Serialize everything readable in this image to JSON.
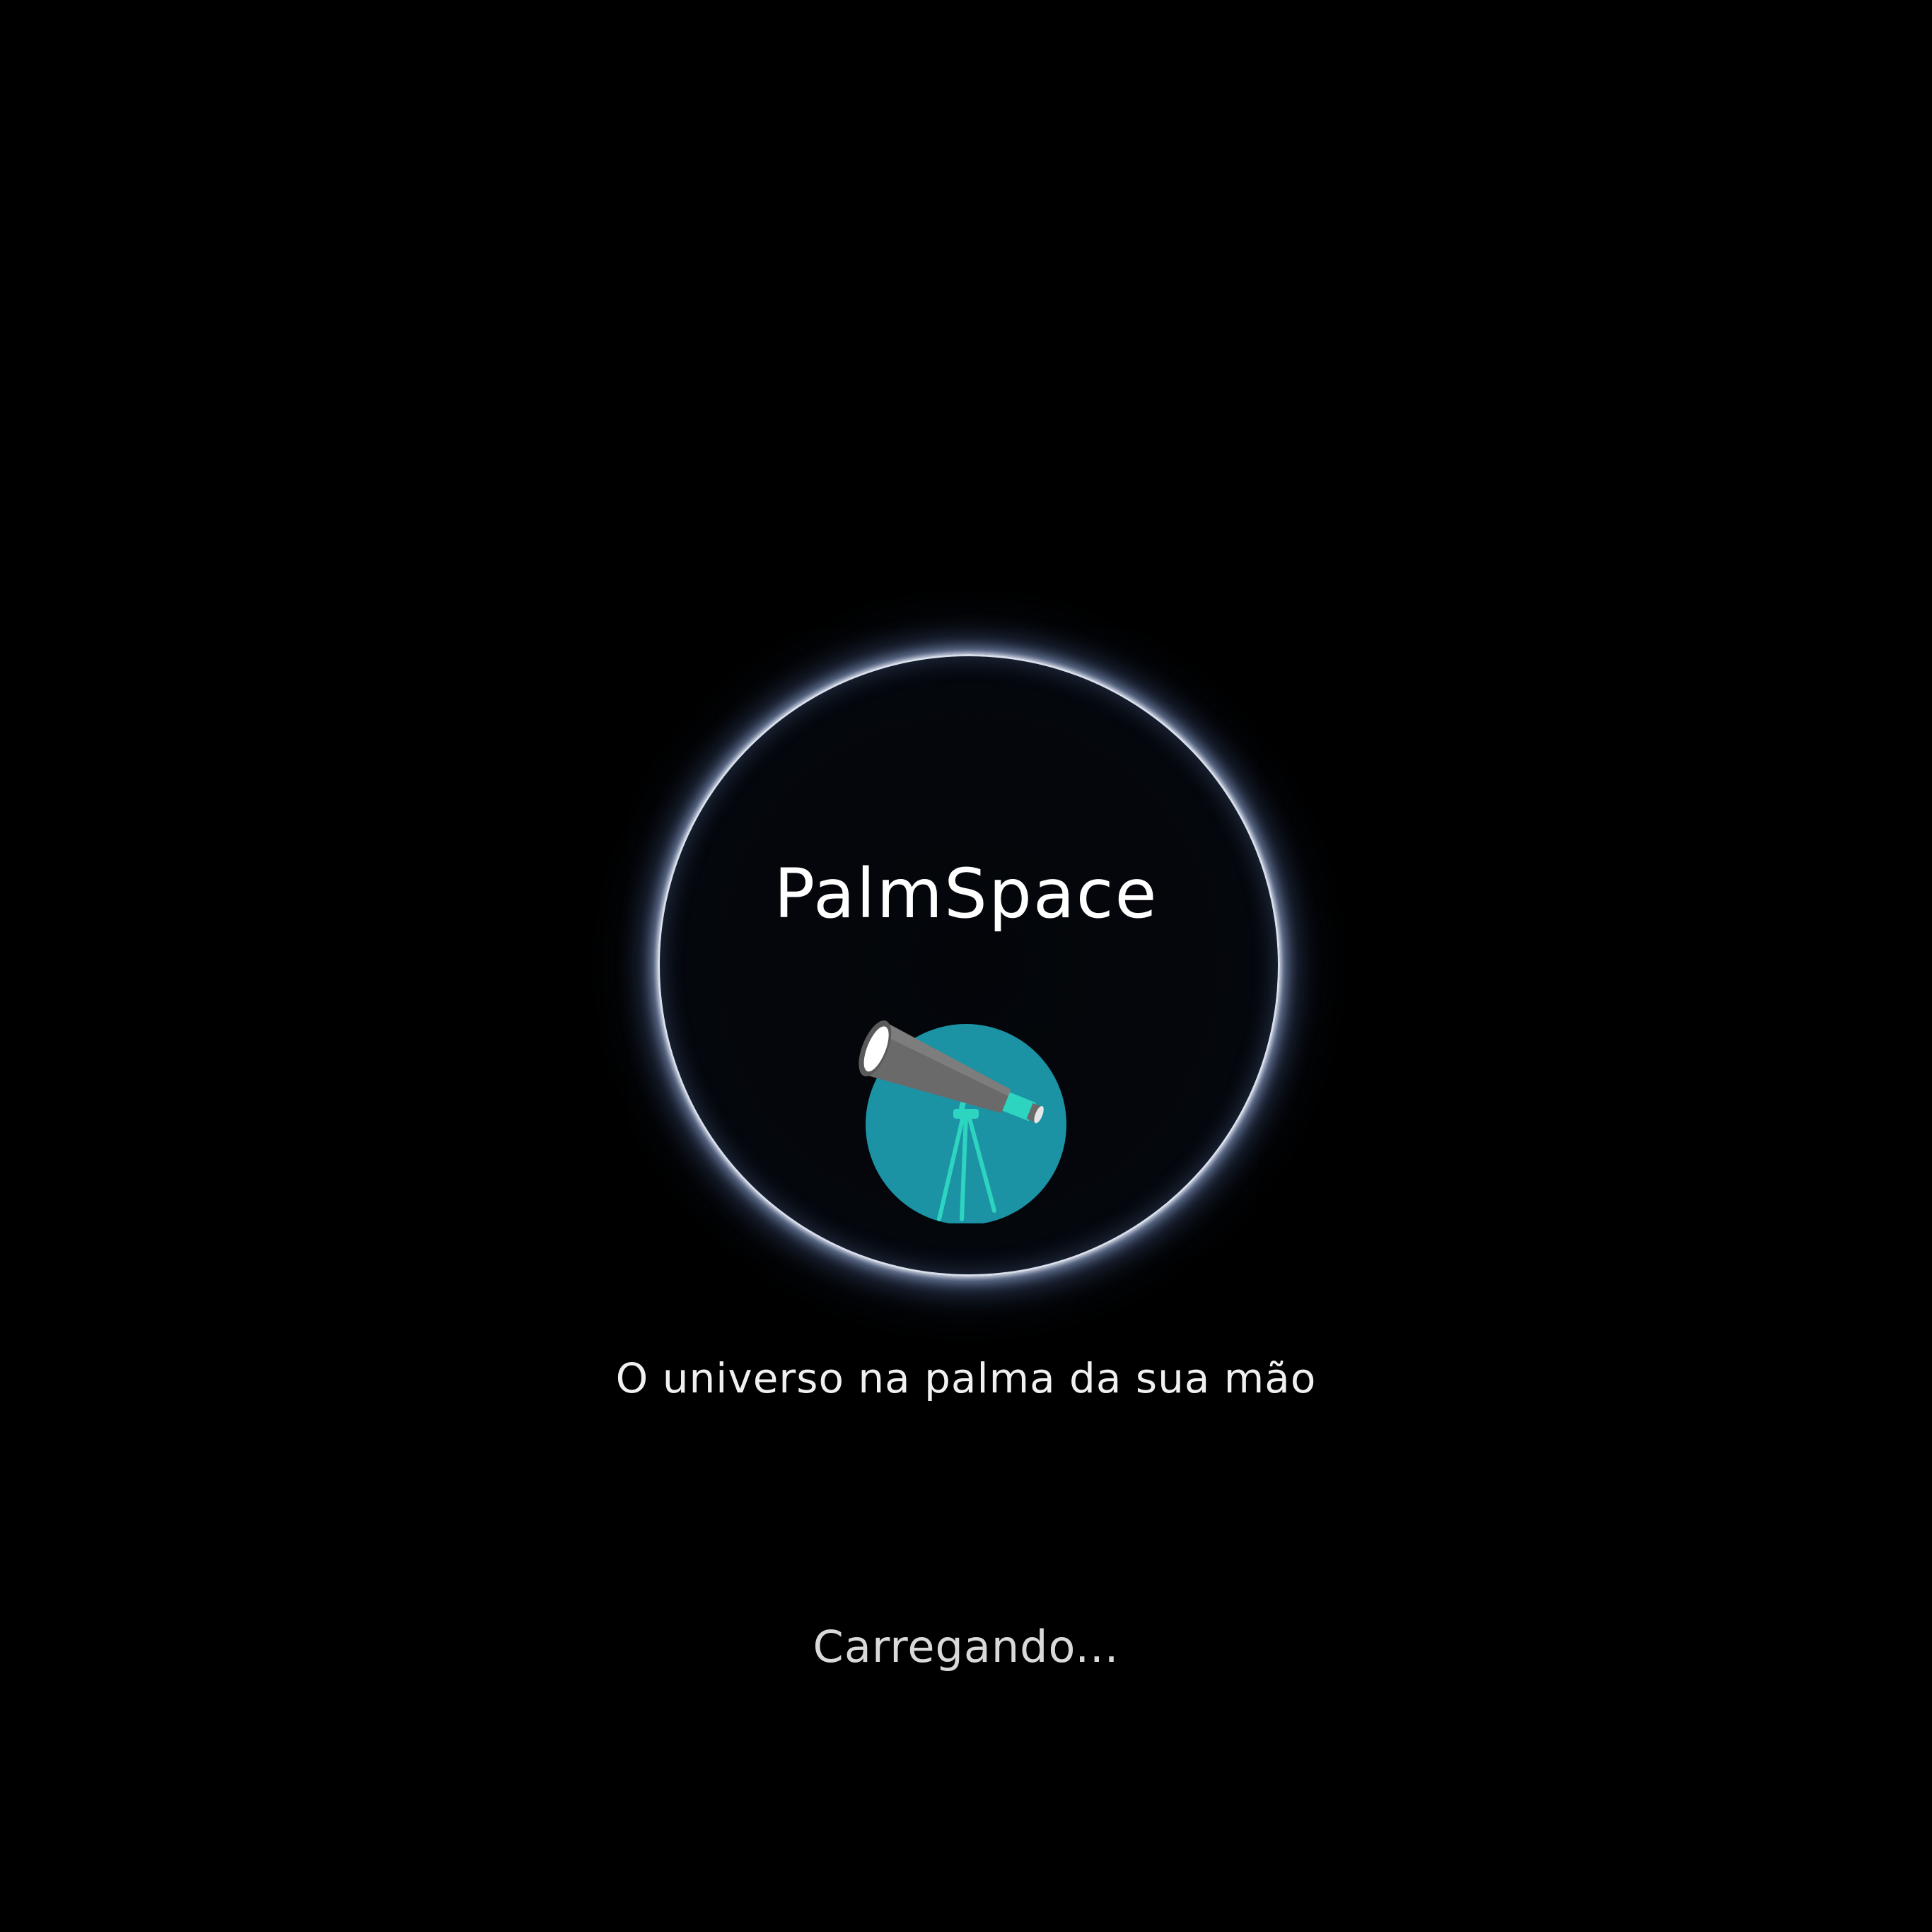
{
  "app": {
    "title": "PalmSpace",
    "tagline": "O universo na palma da sua mão",
    "loading_text": "Carregando..."
  },
  "logo": {
    "icon": "telescope-icon",
    "background_color": "#1b93a5",
    "accent_color": "#2dd4c0",
    "tube_color": "#666666"
  },
  "background": {
    "color": "#000000",
    "ring_glow_color": "#b9cdf5"
  }
}
